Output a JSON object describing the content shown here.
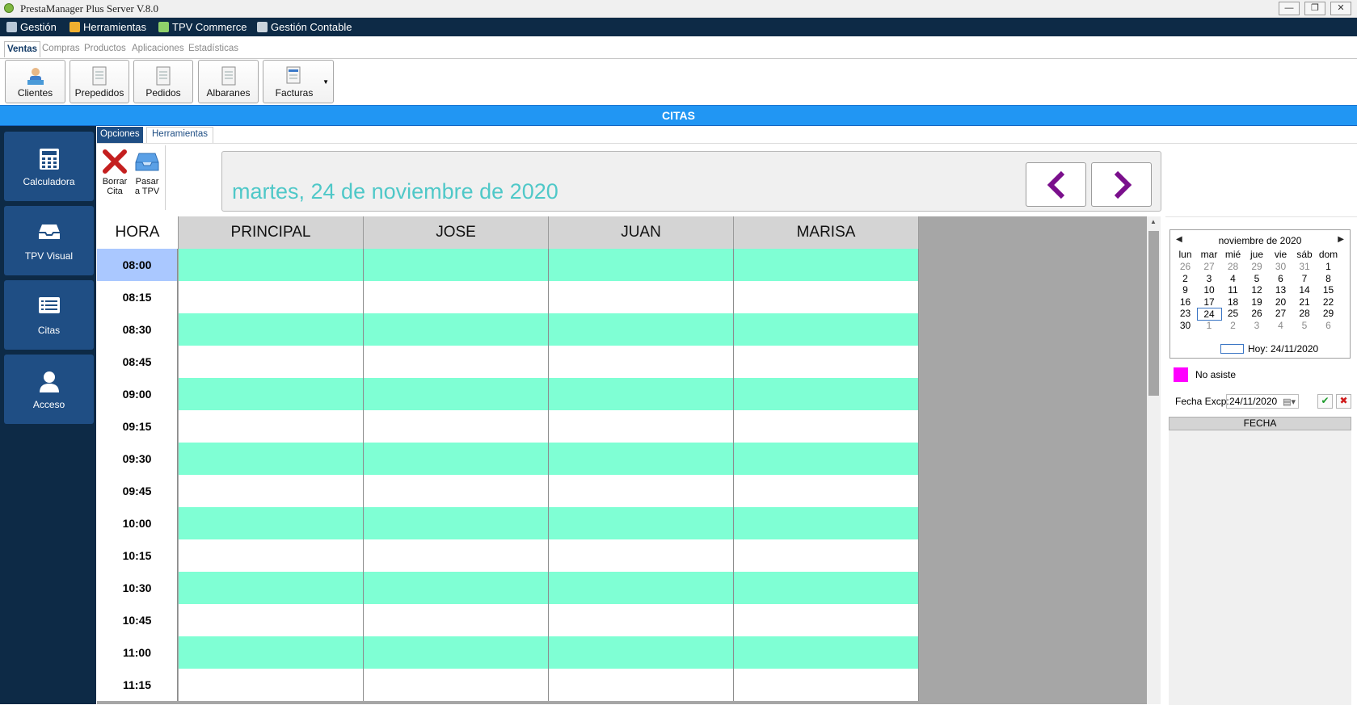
{
  "window": {
    "title": "PrestaManager Plus Server V.8.0"
  },
  "menu": [
    {
      "label": "Gestión",
      "icon": "gear-icon"
    },
    {
      "label": "Herramientas",
      "icon": "tools-icon"
    },
    {
      "label": "TPV Commerce",
      "icon": "cart-icon"
    },
    {
      "label": "Gestión Contable",
      "icon": "ledger-icon"
    }
  ],
  "ribbon_tabs": [
    "Ventas",
    "Compras",
    "Productos",
    "Aplicaciones",
    "Estadísticas"
  ],
  "ribbon_buttons": [
    "Clientes",
    "Prepedidos",
    "Pedidos",
    "Albaranes",
    "Facturas"
  ],
  "section_title": "CITAS",
  "sidebar": [
    "Calculadora",
    "TPV Visual",
    "Citas",
    "Acceso"
  ],
  "option_tabs": [
    "Opciones",
    "Herramientas"
  ],
  "tools": {
    "delete_line1": "Borrar",
    "delete_line2": "Cita",
    "pass_line1": "Pasar",
    "pass_line2": "a TPV"
  },
  "date_label": "martes, 24 de noviembre de 2020",
  "schedule": {
    "hour_header": "HORA",
    "columns": [
      "PRINCIPAL",
      "JOSE",
      "JUAN",
      "MARISA"
    ],
    "times": [
      "08:00",
      "08:15",
      "08:30",
      "08:45",
      "09:00",
      "09:15",
      "09:30",
      "09:45",
      "10:00",
      "10:15",
      "10:30",
      "10:45",
      "11:00",
      "11:15"
    ],
    "selected_time": "08:00"
  },
  "calendar": {
    "title": "noviembre de 2020",
    "weekdays": [
      "lun",
      "mar",
      "mié",
      "jue",
      "vie",
      "sáb",
      "dom"
    ],
    "weeks": [
      [
        "26",
        "27",
        "28",
        "29",
        "30",
        "31",
        "1"
      ],
      [
        "2",
        "3",
        "4",
        "5",
        "6",
        "7",
        "8"
      ],
      [
        "9",
        "10",
        "11",
        "12",
        "13",
        "14",
        "15"
      ],
      [
        "16",
        "17",
        "18",
        "19",
        "20",
        "21",
        "22"
      ],
      [
        "23",
        "24",
        "25",
        "26",
        "27",
        "28",
        "29"
      ],
      [
        "30",
        "1",
        "2",
        "3",
        "4",
        "5",
        "6"
      ]
    ],
    "selected_day": "24",
    "today_label": "Hoy: 24/11/2020"
  },
  "legend": {
    "label": "No asiste",
    "color": "#ff00ff"
  },
  "fecha_excp": {
    "label": "Fecha Excp:",
    "value": "24/11/2020"
  },
  "fecha_header": "FECHA",
  "colors": {
    "accent": "#2196f3",
    "nav": "#0d2a46",
    "sidebar_button": "#1f4e84",
    "row_alt": "#7fffd4",
    "date_text": "#4fc8c8",
    "arrows": "#7a0f8c"
  }
}
